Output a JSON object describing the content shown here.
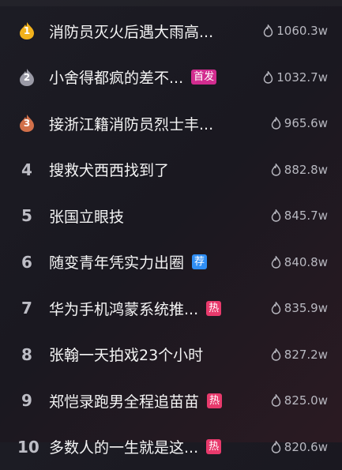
{
  "items": [
    {
      "rank": "1",
      "title": "消防员灭火后遇大雨高...",
      "badge": "",
      "badge_type": "",
      "heat": "1060.3w",
      "medal": "gold"
    },
    {
      "rank": "2",
      "title": "小舍得都疯的差不...",
      "badge": "首发",
      "badge_type": "first",
      "heat": "1032.7w",
      "medal": "silver"
    },
    {
      "rank": "3",
      "title": "接浙江籍消防员烈士丰...",
      "badge": "",
      "badge_type": "",
      "heat": "965.6w",
      "medal": "bronze"
    },
    {
      "rank": "4",
      "title": "搜救犬西西找到了",
      "badge": "",
      "badge_type": "",
      "heat": "882.8w",
      "medal": ""
    },
    {
      "rank": "5",
      "title": "张国立眼技",
      "badge": "",
      "badge_type": "",
      "heat": "845.7w",
      "medal": ""
    },
    {
      "rank": "6",
      "title": "随变青年凭实力出圈",
      "badge": "荐",
      "badge_type": "rec",
      "heat": "840.8w",
      "medal": ""
    },
    {
      "rank": "7",
      "title": "华为手机鸿蒙系统推...",
      "badge": "热",
      "badge_type": "hot",
      "heat": "835.9w",
      "medal": ""
    },
    {
      "rank": "8",
      "title": "张翰一天拍戏23个小时",
      "badge": "",
      "badge_type": "",
      "heat": "827.2w",
      "medal": ""
    },
    {
      "rank": "9",
      "title": "郑恺录跑男全程追苗苗",
      "badge": "热",
      "badge_type": "hot",
      "heat": "825.0w",
      "medal": ""
    },
    {
      "rank": "10",
      "title": "多数人的一生就是这...",
      "badge": "热",
      "badge_type": "hot",
      "heat": "820.6w",
      "medal": ""
    }
  ],
  "colors": {
    "gold": "#f2b21c",
    "silver": "#9a9aa6",
    "bronze": "#d2704a"
  },
  "icons": {
    "heat": "flame-outline-icon",
    "medal": "flame-medal-icon"
  }
}
